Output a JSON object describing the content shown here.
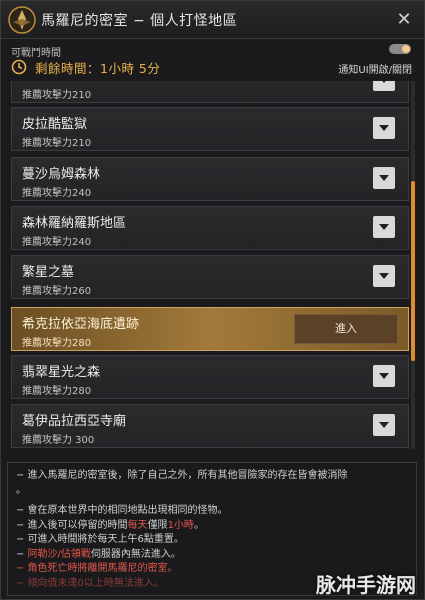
{
  "window": {
    "title": "馬羅尼的密室 − 個人打怪地區",
    "close_label": "✕"
  },
  "timer": {
    "subhead": "可戰鬥時間",
    "remaining": "剩餘時間：1小時 5分"
  },
  "ui_toggle": {
    "label": "通知UI開啟/關閉",
    "on": true
  },
  "dungeons": [
    {
      "name": "",
      "power": "推薦攻擊力210"
    },
    {
      "name": "皮拉酷監獄",
      "power": "推薦攻擊力210"
    },
    {
      "name": "蔓沙烏姆森林",
      "power": "推薦攻擊力240"
    },
    {
      "name": "森林羅納羅斯地區",
      "power": "推薦攻擊力240"
    },
    {
      "name": "繁星之墓",
      "power": "推薦攻擊力260"
    },
    {
      "name": "希克拉依亞海底遺跡",
      "power": "推薦攻擊力280",
      "selected": true,
      "enter_label": "進入"
    },
    {
      "name": "翡翠星光之森",
      "power": "推薦攻擊力280"
    },
    {
      "name": "葛伊品拉西亞寺廟",
      "power": "推薦攻擊力 300"
    }
  ],
  "notes": {
    "n1": "− 進入馬羅尼的密室後，除了自己之外，所有其他冒險家的存在皆會被消除",
    "n1b": "。",
    "n2": "− 會在原本世界中的相同地點出現相同的怪物。",
    "n3a": "− 進入後可以停留的時間",
    "n3b": "每天",
    "n3c": "僅限",
    "n3d": "1小時",
    "n3e": "。",
    "n4": "− 可進入時間將於每天上午6點重置。",
    "n5a": "− ",
    "n5b": "阿勒沙/佔領戰",
    "n5c": "伺服器內無法進入。",
    "n6": "− 角色死亡時將離開馬羅尼的密室。",
    "n7": "− 傾向值未達0以上時無法進入。"
  },
  "watermark": "脉冲手游网",
  "colors": {
    "accent": "#e8b24a",
    "warning_red": "#e2574c",
    "selected_row": "#a27a3a",
    "scroll_thumb": "#e08b2c"
  }
}
